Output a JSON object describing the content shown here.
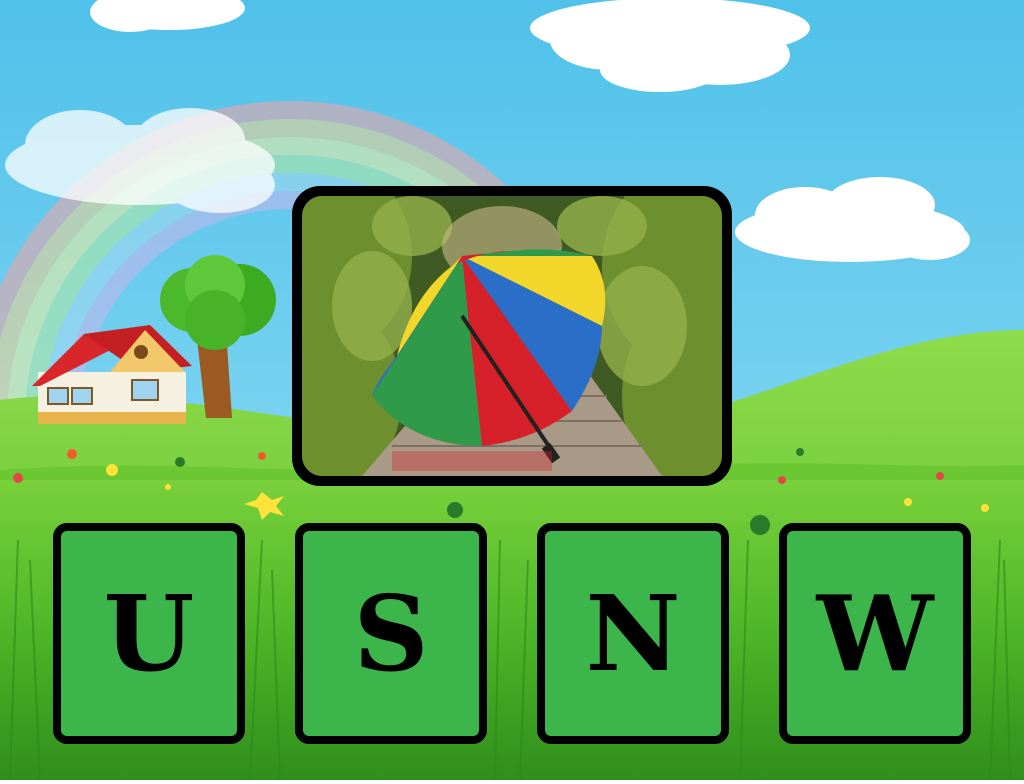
{
  "puzzle": {
    "picture": "umbrella-photo",
    "tiles": [
      {
        "letter": "U"
      },
      {
        "letter": "S"
      },
      {
        "letter": "N"
      },
      {
        "letter": "W"
      }
    ]
  },
  "colors": {
    "sky": "#5cc8ec",
    "grass": "#5ec234",
    "tile": "#3cb54a",
    "tile_border": "#000000"
  }
}
